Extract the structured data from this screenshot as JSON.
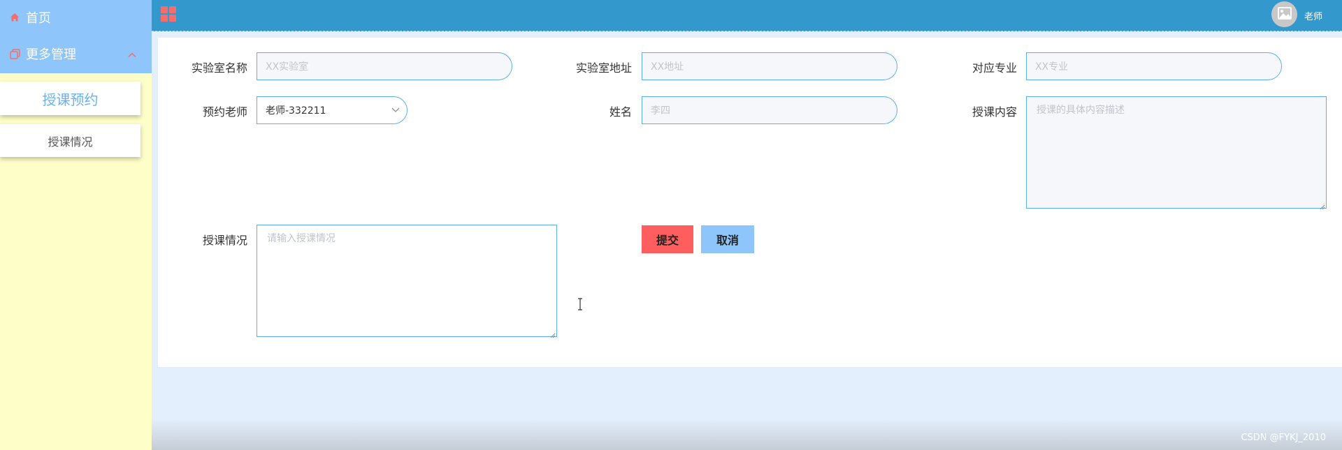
{
  "sidebar": {
    "home_label": "首页",
    "more_label": "更多管理",
    "sub_items": [
      {
        "label": "授课预约",
        "active": true
      },
      {
        "label": "授课情况",
        "active": false
      }
    ]
  },
  "header": {
    "user_name": "老师"
  },
  "form": {
    "lab_name": {
      "label": "实验室名称",
      "placeholder": "XX实验室"
    },
    "lab_address": {
      "label": "实验室地址",
      "placeholder": "XX地址"
    },
    "major": {
      "label": "对应专业",
      "placeholder": "XX专业"
    },
    "teacher": {
      "label": "预约老师",
      "value": "老师-332211"
    },
    "name": {
      "label": "姓名",
      "placeholder": "李四"
    },
    "content": {
      "label": "授课内容",
      "placeholder": "授课的具体内容描述"
    },
    "status": {
      "label": "授课情况",
      "placeholder": "请输入授课情况"
    },
    "submit_label": "提交",
    "cancel_label": "取消"
  },
  "footer": {
    "watermark": "CSDN @FYKJ_2010"
  },
  "colors": {
    "header": "#3399cc",
    "sidebar_menu": "#8ec5fb",
    "sidebar_bg": "#fefec9",
    "submit": "#fe5e5e",
    "cancel": "#8ec5fb",
    "input_border": "#5ab1ea"
  },
  "icons": {
    "home": "home-icon",
    "more": "copy-icon",
    "collapse": "chevron-up-icon",
    "grid": "grid-icon",
    "avatar": "image-icon",
    "select_arrow": "chevron-down-icon"
  }
}
